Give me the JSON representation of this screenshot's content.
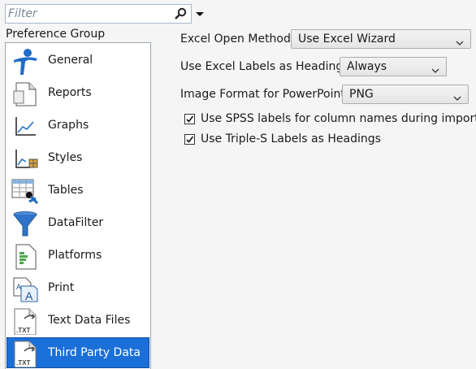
{
  "filter": {
    "placeholder": "Filter",
    "value": ""
  },
  "preference_group": {
    "label": "Preference Group",
    "items": [
      {
        "label": "General",
        "icon": "general-icon"
      },
      {
        "label": "Reports",
        "icon": "reports-icon"
      },
      {
        "label": "Graphs",
        "icon": "graphs-icon"
      },
      {
        "label": "Styles",
        "icon": "styles-icon"
      },
      {
        "label": "Tables",
        "icon": "tables-icon"
      },
      {
        "label": "DataFilter",
        "icon": "funnel-icon"
      },
      {
        "label": "Platforms",
        "icon": "platforms-icon"
      },
      {
        "label": "Print",
        "icon": "print-icon"
      },
      {
        "label": "Text Data Files",
        "icon": "txt-file-icon"
      },
      {
        "label": "Third Party Data",
        "icon": "txt-file-icon",
        "selected": true
      }
    ]
  },
  "settings": {
    "excel_open_method": {
      "label": "Excel Open Method",
      "value": "Use Excel Wizard"
    },
    "excel_labels_headings": {
      "label": "Use Excel Labels as Headings",
      "value": "Always"
    },
    "image_format": {
      "label": "Image Format for PowerPoint",
      "value": "PNG"
    },
    "spss_labels": {
      "label": "Use SPSS labels for column names during import",
      "checked": true
    },
    "triple_s_labels": {
      "label": "Use Triple-S Labels as Headings",
      "checked": true
    }
  },
  "colors": {
    "selection": "#1b6fd8",
    "panel_bg": "#f5f5f5"
  }
}
